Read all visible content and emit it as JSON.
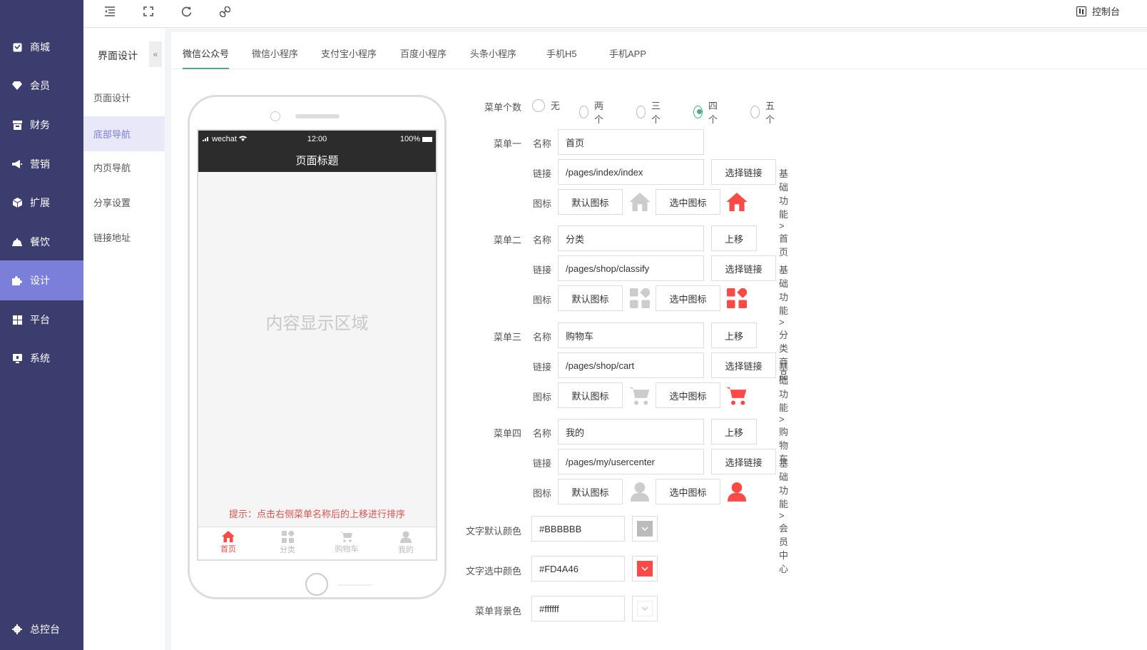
{
  "sidebar": {
    "items": [
      {
        "label": "商城",
        "icon": "shop-icon"
      },
      {
        "label": "会员",
        "icon": "member-icon"
      },
      {
        "label": "财务",
        "icon": "finance-icon"
      },
      {
        "label": "营销",
        "icon": "marketing-icon"
      },
      {
        "label": "扩展",
        "icon": "extend-icon"
      },
      {
        "label": "餐饮",
        "icon": "dining-icon"
      },
      {
        "label": "设计",
        "icon": "design-icon"
      },
      {
        "label": "平台",
        "icon": "platform-icon"
      },
      {
        "label": "系统",
        "icon": "system-icon"
      }
    ],
    "active": "设计",
    "bottom_label": "总控台"
  },
  "topbar": {
    "console_label": "控制台"
  },
  "subnav": {
    "title": "界面设计",
    "collapse_glyph": "«",
    "items": [
      {
        "label": "页面设计"
      },
      {
        "label": "底部导航"
      },
      {
        "label": "内页导航"
      },
      {
        "label": "分享设置"
      },
      {
        "label": "链接地址"
      }
    ],
    "active": "底部导航"
  },
  "tabs": [
    {
      "label": "微信公众号"
    },
    {
      "label": "微信小程序"
    },
    {
      "label": "支付宝小程序"
    },
    {
      "label": "百度小程序"
    },
    {
      "label": "头条小程序"
    },
    {
      "label": "手机H5"
    },
    {
      "label": "手机APP"
    }
  ],
  "active_tab": "微信公众号",
  "phone": {
    "carrier": "wechat",
    "time": "12:00",
    "battery": "100%",
    "page_title": "页面标题",
    "content_label": "内容显示区域",
    "hint": "提示：点击右侧菜单名称后的上移进行排序",
    "tabbar": [
      {
        "label": "首页",
        "icon": "home-icon"
      },
      {
        "label": "分类",
        "icon": "category-icon"
      },
      {
        "label": "购物车",
        "icon": "cart-icon"
      },
      {
        "label": "我的",
        "icon": "user-icon"
      }
    ]
  },
  "form": {
    "menu_count_label": "菜单个数",
    "menu_count_options": [
      "无",
      "两个",
      "三个",
      "四个",
      "五个"
    ],
    "menu_count_selected": "四个",
    "name_label": "名称",
    "link_label": "链接",
    "icon_label": "图标",
    "choose_link_label": "选择链接",
    "move_up_label": "上移",
    "default_icon_label": "默认图标",
    "selected_icon_label": "选中图标",
    "menus": [
      {
        "title": "菜单一",
        "name": "首页",
        "link": "/pages/index/index",
        "path": "基础功能>首页",
        "icon": "home-icon"
      },
      {
        "title": "菜单二",
        "name": "分类",
        "link": "/pages/shop/classify",
        "path": "基础功能>分类商品",
        "icon": "category-icon"
      },
      {
        "title": "菜单三",
        "name": "购物车",
        "link": "/pages/shop/cart",
        "path": "基础功能>购物车",
        "icon": "cart-icon"
      },
      {
        "title": "菜单四",
        "name": "我的",
        "link": "/pages/my/usercenter",
        "path": "基础功能>会员中心",
        "icon": "user-icon"
      }
    ],
    "text_default_color_label": "文字默认颜色",
    "text_default_color": "#BBBBBB",
    "text_selected_color_label": "文字选中颜色",
    "text_selected_color": "#FD4A46",
    "menu_bg_color_label": "菜单背景色",
    "menu_bg_color": "#ffffff"
  },
  "colors": {
    "sidebar_bg": "#3b3d6e",
    "sidebar_active": "#7b7fd9",
    "accent_green": "#4caf7d",
    "icon_selected": "#fd4a46",
    "icon_default": "#cccccc"
  }
}
